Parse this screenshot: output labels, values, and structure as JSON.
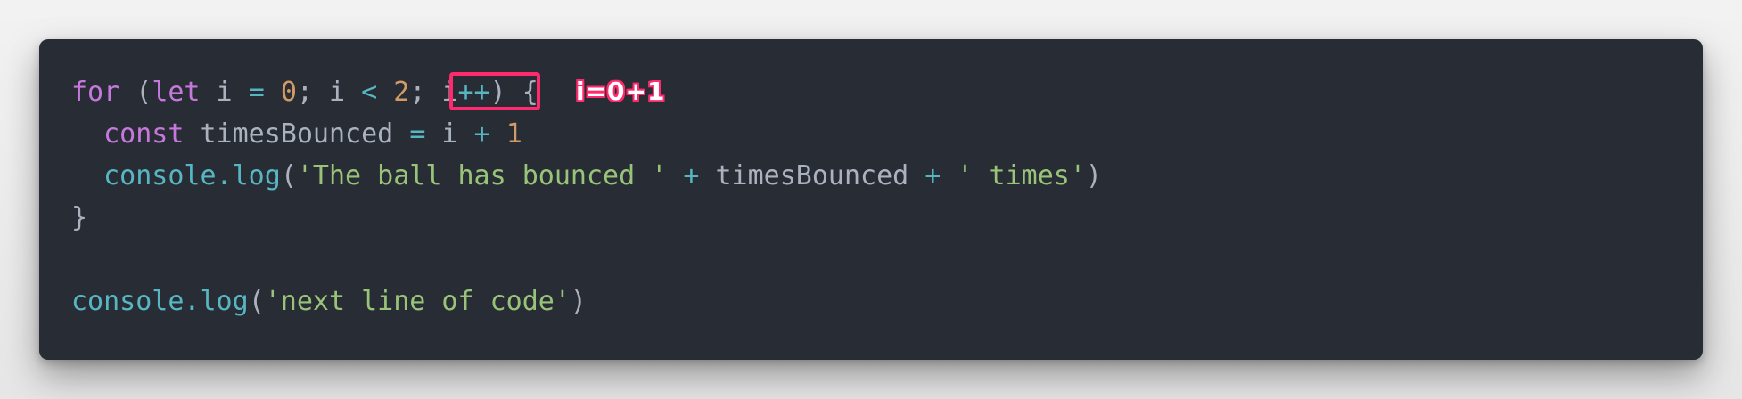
{
  "code": {
    "l1": {
      "t1": "for",
      "t2": " (",
      "t3": "let",
      "t4": " i ",
      "t5": "=",
      "t6": " ",
      "t7": "0",
      "t8": "; i ",
      "t9": "<",
      "t10": " ",
      "t11": "2",
      "t12": "; ",
      "t13": "i",
      "t14": "++",
      "t15": ") {"
    },
    "l2": {
      "t1": "  ",
      "t2": "const",
      "t3": " timesBounced ",
      "t4": "=",
      "t5": " i ",
      "t6": "+",
      "t7": " ",
      "t8": "1"
    },
    "l3": {
      "t1": "  ",
      "t2": "console.log",
      "t3": "(",
      "t4": "'The ball has bounced '",
      "t5": " ",
      "t6": "+",
      "t7": " timesBounced ",
      "t8": "+",
      "t9": " ",
      "t10": "' times'",
      "t11": ")"
    },
    "l4": "}",
    "l6": {
      "t1": "console.log",
      "t2": "(",
      "t3": "'next line of code'",
      "t4": ")"
    }
  },
  "annotation": "i=0+1",
  "colors": {
    "background": "#282c34",
    "keyword": "#c678dd",
    "number": "#d19a66",
    "operator": "#56b6c2",
    "string": "#98c379",
    "text": "#abb2bf",
    "highlight": "#ff2a6d"
  }
}
